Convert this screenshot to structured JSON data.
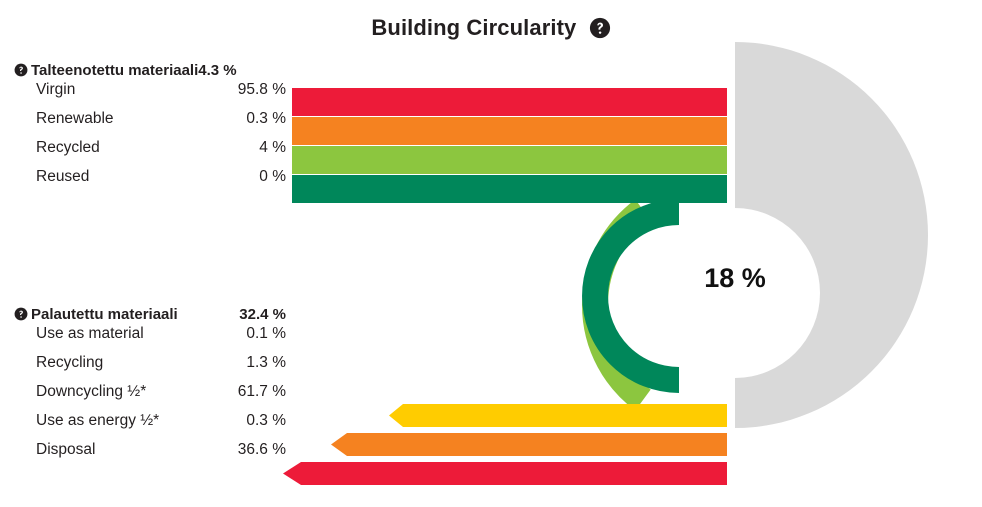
{
  "header": {
    "title": "Building Circularity",
    "help_icon": "help-circle-icon"
  },
  "center": {
    "value": "18 %"
  },
  "groups": [
    {
      "id": "recovered",
      "help_icon": "help-circle-icon",
      "label": "Talteenotettu materiaali",
      "value": "4.3 %",
      "rows": [
        {
          "label": "Virgin",
          "value": "95.8 %",
          "color": "#ED1B39"
        },
        {
          "label": "Renewable",
          "value": "0.3 %",
          "color": "#F58220"
        },
        {
          "label": "Recycled",
          "value": "4 %",
          "color": "#8CC63F"
        },
        {
          "label": "Reused",
          "value": "0 %",
          "color": "#00875A"
        }
      ]
    },
    {
      "id": "returned",
      "help_icon": "help-circle-icon",
      "label": "Palautettu materiaali",
      "value": "32.4 %",
      "rows": [
        {
          "label": "Use as material",
          "value": "0.1 %",
          "color": "#00875A"
        },
        {
          "label": "Recycling",
          "value": "1.3 %",
          "color": "#8CC63F"
        },
        {
          "label": "Downcycling ½*",
          "value": "61.7 %",
          "color": "#FFCC00"
        },
        {
          "label": "Use as energy ½*",
          "value": "0.3 %",
          "color": "#F58220"
        },
        {
          "label": "Disposal",
          "value": "36.6 %",
          "color": "#ED1B39"
        }
      ]
    }
  ],
  "colors": {
    "red": "#ED1B39",
    "orange": "#F58220",
    "yellow": "#FFCC00",
    "light_green": "#8CC63F",
    "dark_green": "#00875A",
    "gray": "#D9D9D9",
    "text": "#231f20",
    "background": "#ffffff"
  },
  "chart_data": {
    "type": "bar",
    "title": "Building Circularity",
    "xlabel": "",
    "ylabel": "",
    "grid": false,
    "legend_position": "left",
    "center_label": "18 %",
    "center_value": 18,
    "series": [
      {
        "name": "Talteenotettu materiaali",
        "group_value": 4.3,
        "categories": [
          "Virgin",
          "Renewable",
          "Recycled",
          "Reused"
        ],
        "values": [
          95.8,
          0.3,
          4,
          0
        ],
        "colors": [
          "#ED1B39",
          "#F58220",
          "#8CC63F",
          "#00875A"
        ]
      },
      {
        "name": "Palautettu materiaali",
        "group_value": 32.4,
        "categories": [
          "Use as material",
          "Recycling",
          "Downcycling ½*",
          "Use as energy ½*",
          "Disposal"
        ],
        "values": [
          0.1,
          1.3,
          61.7,
          0.3,
          36.6
        ],
        "colors": [
          "#00875A",
          "#8CC63F",
          "#FFCC00",
          "#F58220",
          "#ED1B39"
        ]
      }
    ],
    "donut": {
      "arcs": [
        {
          "name": "outer-arc",
          "color": "#8CC63F"
        },
        {
          "name": "inner-arc",
          "color": "#00875A"
        }
      ],
      "track_color": "#D9D9D9"
    }
  }
}
